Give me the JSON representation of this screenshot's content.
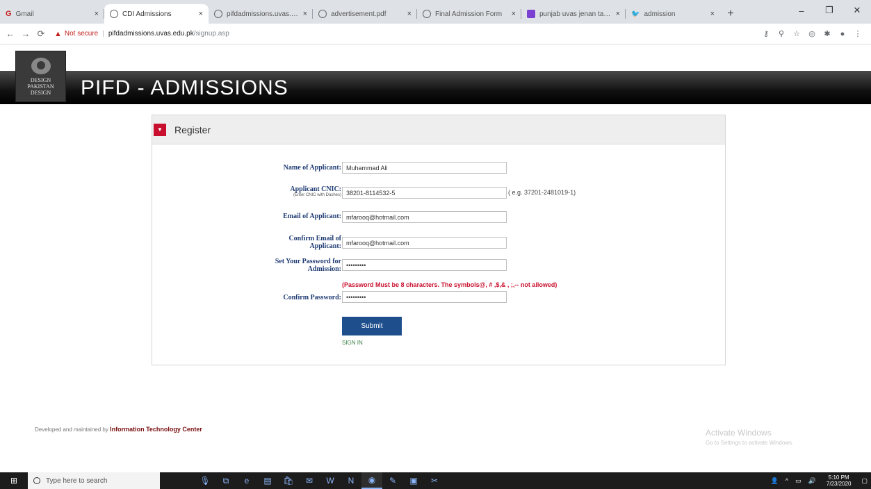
{
  "browser": {
    "tabs": [
      {
        "label": "Gmail",
        "icon": "gmail-icon",
        "active": false
      },
      {
        "label": "CDI Admissions",
        "icon": "globe-icon",
        "active": true
      },
      {
        "label": "pifdadmissions.uvas.edu",
        "icon": "globe-icon",
        "active": false
      },
      {
        "label": "advertisement.pdf",
        "icon": "globe-icon",
        "active": false
      },
      {
        "label": "Final Admission Form",
        "icon": "globe-icon",
        "active": false
      },
      {
        "label": "punjab uvas jenan tanzi",
        "icon": "purple-square-icon",
        "active": false
      },
      {
        "label": "admission",
        "icon": "bird-icon",
        "active": false
      }
    ],
    "address": {
      "not_secure": "Not secure",
      "host": "pifdadmissions.uvas.edu.pk",
      "path": "/signup.asp"
    }
  },
  "site": {
    "logo_text": [
      "DESIGN",
      "PAKISTAN",
      "DESIGN"
    ],
    "title": "PIFD - ADMISSIONS"
  },
  "register": {
    "title": "Register",
    "fields": {
      "name": {
        "label": "Name of Applicant:",
        "value": "Muhammad Ali"
      },
      "cnic": {
        "label": "Applicant CNIC:",
        "hint": "(Enter CNIC with Dashes)",
        "value": "38201-8114532-5",
        "example": "( e.g. 37201-2481019-1)"
      },
      "email": {
        "label": "Email of Applicant:",
        "value": "mfarooq@hotmail.com"
      },
      "confirm_email": {
        "label": "Confirm Email of Applicant:",
        "value": "mfarooq@hotmail.com"
      },
      "password": {
        "label": "Set Your Password for Admission:",
        "value": "•••••••••"
      },
      "password_note": "(Password Must be 8 characters. The symbols@, # ,$,& , ;,-- not allowed)",
      "confirm_password": {
        "label": "Confirm Password:",
        "value": "•••••••••"
      }
    },
    "submit_label": "Submit",
    "signin_label": "SIGN IN"
  },
  "footer": {
    "prefix": "Developed and maintained by",
    "org": "Information Technology Center"
  },
  "watermark": {
    "title": "Activate Windows",
    "subtitle": "Go to Settings to activate Windows."
  },
  "taskbar": {
    "search_placeholder": "Type here to search",
    "time": "5:10 PM",
    "date": "7/23/2020"
  },
  "colors": {
    "accent_red": "#c8102e",
    "submit_blue": "#1f4e8c",
    "label_blue": "#1f3b73"
  }
}
